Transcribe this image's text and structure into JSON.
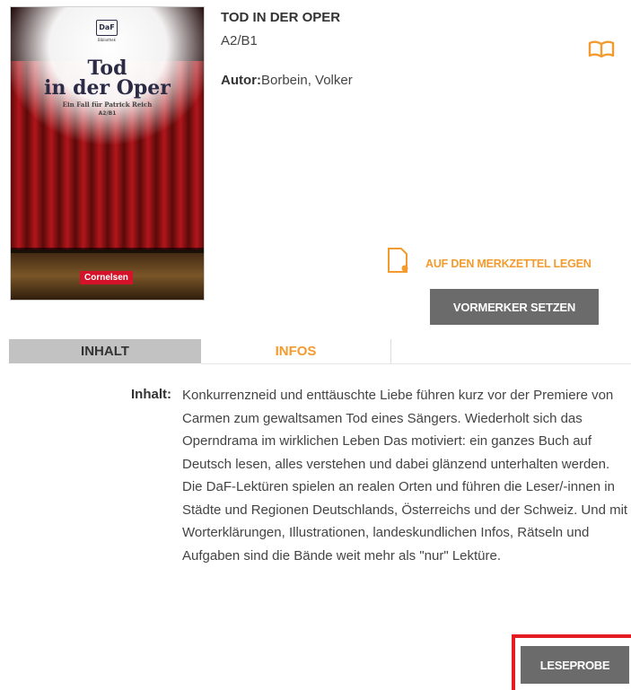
{
  "book": {
    "title": "TOD IN DER OPER",
    "level": "A2/B1",
    "author_label": "Autor:",
    "author_name": "Borbein, Volker"
  },
  "cover": {
    "series_logo": "DaF",
    "series_logo_sub": "Bibliothek",
    "title_line1": "Tod",
    "title_line2": "in der Oper",
    "subtitle": "Ein Fall für Patrick Reich",
    "level": "A2/B1",
    "publisher": "Cornelsen"
  },
  "actions": {
    "merkzettel_label": "AUF DEN MERKZETTEL LEGEN",
    "vormerker_label": "VORMERKER SETZEN",
    "leseprobe_label": "LESEPROBE"
  },
  "tabs": [
    {
      "label": "INHALT",
      "active": true
    },
    {
      "label": "INFOS",
      "active": false
    }
  ],
  "content": {
    "label": "Inhalt:",
    "text": "Konkurrenzneid und enttäuschte Liebe führen kurz vor der Premiere von Carmen zum gewaltsamen Tod eines Sängers. Wiederholt sich das Operndrama im wirklichen Leben Das motiviert: ein ganzes Buch auf Deutsch lesen, alles verstehen und dabei glänzend unterhalten werden. Die DaF-Lektüren spielen an realen Orten und führen die Leser/-innen in Städte und Regionen Deutschlands, Österreichs und der Schweiz. Und mit Worterklärungen, Illustrationen, landeskundlichen Infos, Rätseln und Aufgaben sind die Bände weit mehr als \"nur\" Lektüre."
  },
  "colors": {
    "accent": "#f39b2e",
    "button_bg": "#6b6b6b",
    "tab_active_bg": "#c2c2c2",
    "highlight": "#e31b23",
    "publisher_red": "#d4122a"
  },
  "icons": {
    "open_book": "book-open-icon",
    "notepad": "notepad-icon"
  }
}
